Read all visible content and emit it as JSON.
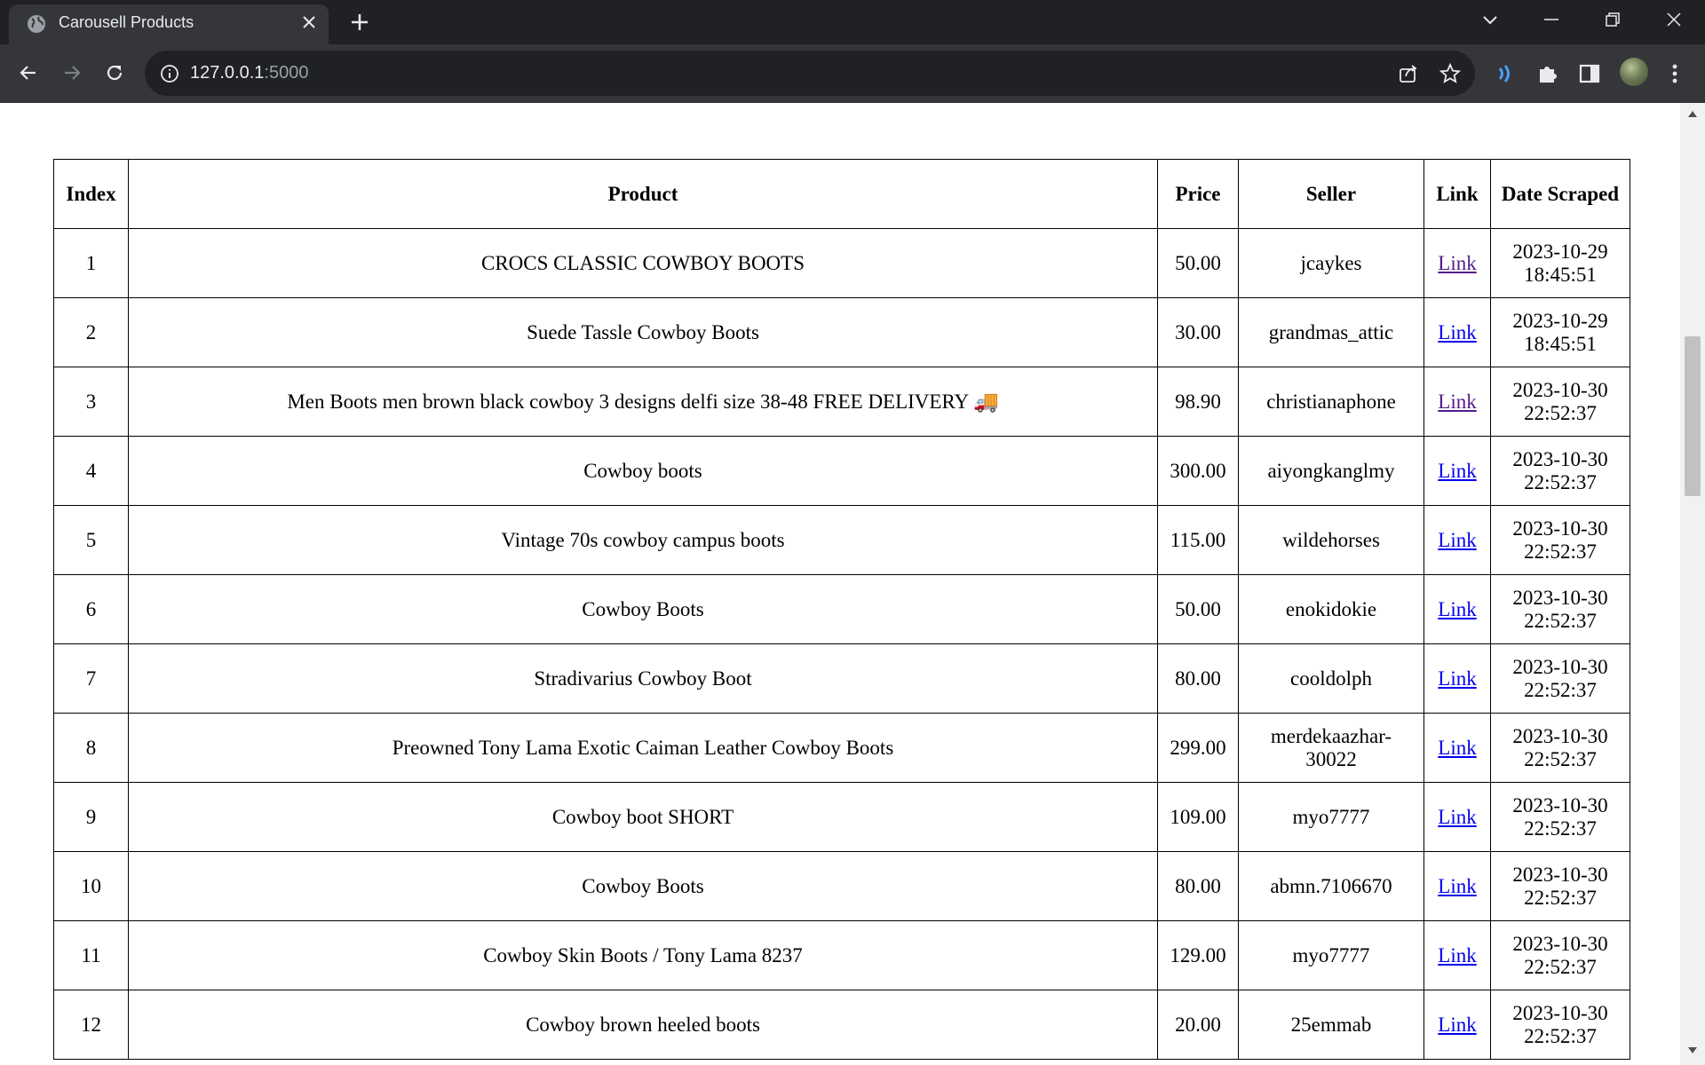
{
  "browser": {
    "tab_title": "Carousell Products",
    "url_host": "127.0.0.1",
    "url_port": ":5000"
  },
  "table": {
    "headers": [
      "Index",
      "Product",
      "Price",
      "Seller",
      "Link",
      "Date Scraped"
    ],
    "rows": [
      {
        "index": "1",
        "product": "CROCS CLASSIC COWBOY BOOTS",
        "price": "50.00",
        "seller": "jcaykes",
        "link": "Link",
        "visited": true,
        "date": "2023-10-29",
        "time": "18:45:51"
      },
      {
        "index": "2",
        "product": "Suede Tassle Cowboy Boots",
        "price": "30.00",
        "seller": "grandmas_attic",
        "link": "Link",
        "visited": false,
        "date": "2023-10-29",
        "time": "18:45:51"
      },
      {
        "index": "3",
        "product": "Men Boots men brown black cowboy 3 designs delfi size 38-48 FREE DELIVERY 🚚",
        "price": "98.90",
        "seller": "christianaphone",
        "link": "Link",
        "visited": true,
        "date": "2023-10-30",
        "time": "22:52:37"
      },
      {
        "index": "4",
        "product": "Cowboy boots",
        "price": "300.00",
        "seller": "aiyongkanglmy",
        "link": "Link",
        "visited": false,
        "date": "2023-10-30",
        "time": "22:52:37"
      },
      {
        "index": "5",
        "product": "Vintage 70s cowboy campus boots",
        "price": "115.00",
        "seller": "wildehorses",
        "link": "Link",
        "visited": false,
        "date": "2023-10-30",
        "time": "22:52:37"
      },
      {
        "index": "6",
        "product": "Cowboy Boots",
        "price": "50.00",
        "seller": "enokidokie",
        "link": "Link",
        "visited": false,
        "date": "2023-10-30",
        "time": "22:52:37"
      },
      {
        "index": "7",
        "product": "Stradivarius Cowboy Boot",
        "price": "80.00",
        "seller": "cooldolph",
        "link": "Link",
        "visited": false,
        "date": "2023-10-30",
        "time": "22:52:37"
      },
      {
        "index": "8",
        "product": "Preowned Tony Lama Exotic Caiman Leather Cowboy Boots",
        "price": "299.00",
        "seller": "merdekaazhar-30022",
        "link": "Link",
        "visited": false,
        "date": "2023-10-30",
        "time": "22:52:37"
      },
      {
        "index": "9",
        "product": "Cowboy boot SHORT",
        "price": "109.00",
        "seller": "myo7777",
        "link": "Link",
        "visited": false,
        "date": "2023-10-30",
        "time": "22:52:37"
      },
      {
        "index": "10",
        "product": "Cowboy Boots",
        "price": "80.00",
        "seller": "abmn.7106670",
        "link": "Link",
        "visited": false,
        "date": "2023-10-30",
        "time": "22:52:37"
      },
      {
        "index": "11",
        "product": "Cowboy Skin Boots / Tony Lama 8237",
        "price": "129.00",
        "seller": "myo7777",
        "link": "Link",
        "visited": false,
        "date": "2023-10-30",
        "time": "22:52:37"
      },
      {
        "index": "12",
        "product": "Cowboy brown heeled boots",
        "price": "20.00",
        "seller": "25emmab",
        "link": "Link",
        "visited": false,
        "date": "2023-10-30",
        "time": "22:52:37"
      }
    ]
  },
  "colors": {
    "link": "#0000ee",
    "link_visited": "#551a8b",
    "chrome_dark": "#202124",
    "chrome_toolbar": "#35363a",
    "extension_accent": "#4a9ff5"
  },
  "icons": [
    "globe-icon",
    "close-icon",
    "plus-icon",
    "chevron-down-icon",
    "minimize-icon",
    "restore-icon",
    "close-window-icon",
    "back-icon",
    "forward-icon",
    "reload-icon",
    "info-icon",
    "share-icon",
    "star-icon",
    "extension-wave-icon",
    "puzzle-icon",
    "side-panel-icon",
    "avatar",
    "more-vert-icon"
  ]
}
